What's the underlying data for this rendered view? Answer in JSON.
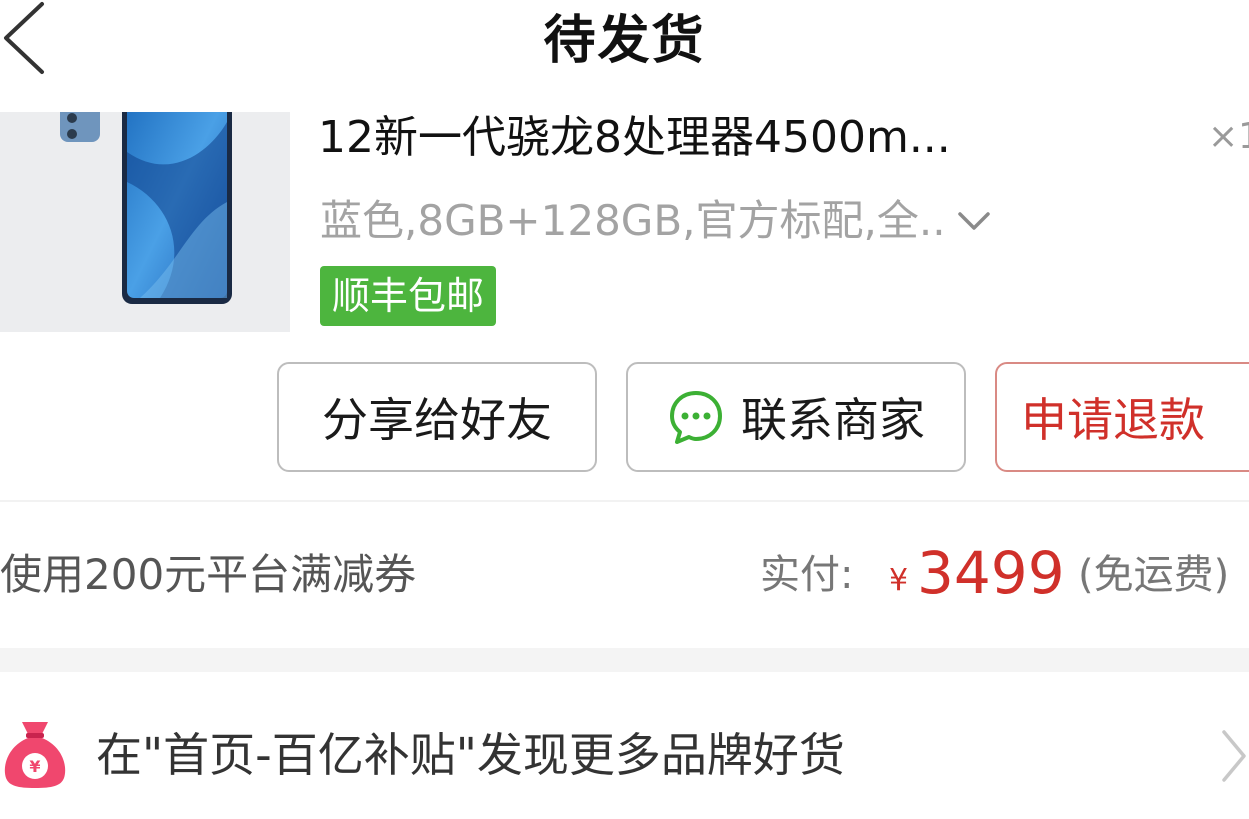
{
  "header": {
    "title": "待发货",
    "back_icon": "chevron-left-icon"
  },
  "product": {
    "name": "12新一代骁龙8处理器4500m...",
    "quantity": "×1",
    "spec": "蓝色,8GB+128GB,官方标配,全..",
    "badge": "顺丰包邮"
  },
  "actions": {
    "share": "分享给好友",
    "contact": "联系商家",
    "refund": "申请退款"
  },
  "payment": {
    "coupon": "使用200元平台满减券",
    "paid_label": "实付:",
    "currency": "¥",
    "amount": "3499",
    "shipping": "(免运费)"
  },
  "promo": {
    "text": "在\"首页-百亿补贴\"发现更多品牌好货",
    "icon": "money-bag-icon"
  },
  "colors": {
    "accent_red": "#d0302a",
    "badge_green": "#4db53e",
    "wechat_green": "#3cb034",
    "promo_pink": "#f0476e"
  }
}
